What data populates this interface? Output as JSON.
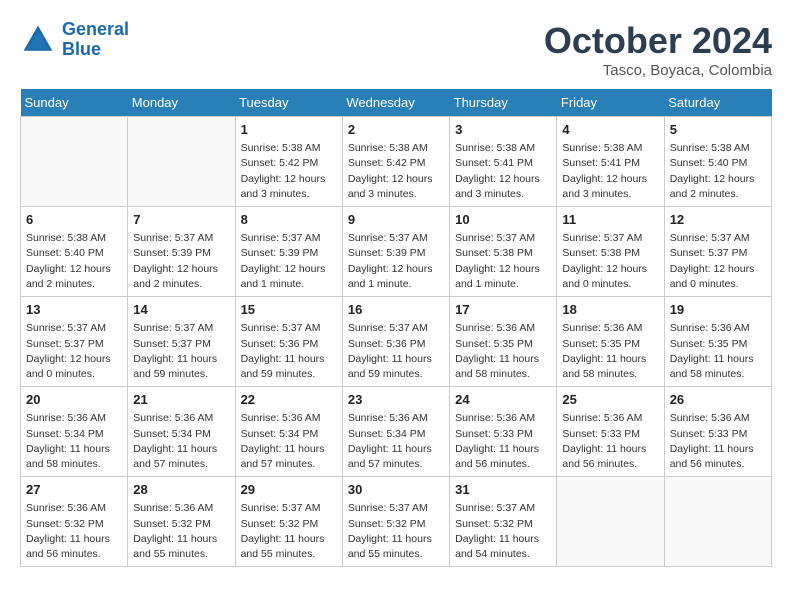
{
  "header": {
    "logo_line1": "General",
    "logo_line2": "Blue",
    "month": "October 2024",
    "location": "Tasco, Boyaca, Colombia"
  },
  "weekdays": [
    "Sunday",
    "Monday",
    "Tuesday",
    "Wednesday",
    "Thursday",
    "Friday",
    "Saturday"
  ],
  "weeks": [
    [
      {
        "day": "",
        "info": ""
      },
      {
        "day": "",
        "info": ""
      },
      {
        "day": "1",
        "info": "Sunrise: 5:38 AM\nSunset: 5:42 PM\nDaylight: 12 hours\nand 3 minutes."
      },
      {
        "day": "2",
        "info": "Sunrise: 5:38 AM\nSunset: 5:42 PM\nDaylight: 12 hours\nand 3 minutes."
      },
      {
        "day": "3",
        "info": "Sunrise: 5:38 AM\nSunset: 5:41 PM\nDaylight: 12 hours\nand 3 minutes."
      },
      {
        "day": "4",
        "info": "Sunrise: 5:38 AM\nSunset: 5:41 PM\nDaylight: 12 hours\nand 3 minutes."
      },
      {
        "day": "5",
        "info": "Sunrise: 5:38 AM\nSunset: 5:40 PM\nDaylight: 12 hours\nand 2 minutes."
      }
    ],
    [
      {
        "day": "6",
        "info": "Sunrise: 5:38 AM\nSunset: 5:40 PM\nDaylight: 12 hours\nand 2 minutes."
      },
      {
        "day": "7",
        "info": "Sunrise: 5:37 AM\nSunset: 5:39 PM\nDaylight: 12 hours\nand 2 minutes."
      },
      {
        "day": "8",
        "info": "Sunrise: 5:37 AM\nSunset: 5:39 PM\nDaylight: 12 hours\nand 1 minute."
      },
      {
        "day": "9",
        "info": "Sunrise: 5:37 AM\nSunset: 5:39 PM\nDaylight: 12 hours\nand 1 minute."
      },
      {
        "day": "10",
        "info": "Sunrise: 5:37 AM\nSunset: 5:38 PM\nDaylight: 12 hours\nand 1 minute."
      },
      {
        "day": "11",
        "info": "Sunrise: 5:37 AM\nSunset: 5:38 PM\nDaylight: 12 hours\nand 0 minutes."
      },
      {
        "day": "12",
        "info": "Sunrise: 5:37 AM\nSunset: 5:37 PM\nDaylight: 12 hours\nand 0 minutes."
      }
    ],
    [
      {
        "day": "13",
        "info": "Sunrise: 5:37 AM\nSunset: 5:37 PM\nDaylight: 12 hours\nand 0 minutes."
      },
      {
        "day": "14",
        "info": "Sunrise: 5:37 AM\nSunset: 5:37 PM\nDaylight: 11 hours\nand 59 minutes."
      },
      {
        "day": "15",
        "info": "Sunrise: 5:37 AM\nSunset: 5:36 PM\nDaylight: 11 hours\nand 59 minutes."
      },
      {
        "day": "16",
        "info": "Sunrise: 5:37 AM\nSunset: 5:36 PM\nDaylight: 11 hours\nand 59 minutes."
      },
      {
        "day": "17",
        "info": "Sunrise: 5:36 AM\nSunset: 5:35 PM\nDaylight: 11 hours\nand 58 minutes."
      },
      {
        "day": "18",
        "info": "Sunrise: 5:36 AM\nSunset: 5:35 PM\nDaylight: 11 hours\nand 58 minutes."
      },
      {
        "day": "19",
        "info": "Sunrise: 5:36 AM\nSunset: 5:35 PM\nDaylight: 11 hours\nand 58 minutes."
      }
    ],
    [
      {
        "day": "20",
        "info": "Sunrise: 5:36 AM\nSunset: 5:34 PM\nDaylight: 11 hours\nand 58 minutes."
      },
      {
        "day": "21",
        "info": "Sunrise: 5:36 AM\nSunset: 5:34 PM\nDaylight: 11 hours\nand 57 minutes."
      },
      {
        "day": "22",
        "info": "Sunrise: 5:36 AM\nSunset: 5:34 PM\nDaylight: 11 hours\nand 57 minutes."
      },
      {
        "day": "23",
        "info": "Sunrise: 5:36 AM\nSunset: 5:34 PM\nDaylight: 11 hours\nand 57 minutes."
      },
      {
        "day": "24",
        "info": "Sunrise: 5:36 AM\nSunset: 5:33 PM\nDaylight: 11 hours\nand 56 minutes."
      },
      {
        "day": "25",
        "info": "Sunrise: 5:36 AM\nSunset: 5:33 PM\nDaylight: 11 hours\nand 56 minutes."
      },
      {
        "day": "26",
        "info": "Sunrise: 5:36 AM\nSunset: 5:33 PM\nDaylight: 11 hours\nand 56 minutes."
      }
    ],
    [
      {
        "day": "27",
        "info": "Sunrise: 5:36 AM\nSunset: 5:32 PM\nDaylight: 11 hours\nand 56 minutes."
      },
      {
        "day": "28",
        "info": "Sunrise: 5:36 AM\nSunset: 5:32 PM\nDaylight: 11 hours\nand 55 minutes."
      },
      {
        "day": "29",
        "info": "Sunrise: 5:37 AM\nSunset: 5:32 PM\nDaylight: 11 hours\nand 55 minutes."
      },
      {
        "day": "30",
        "info": "Sunrise: 5:37 AM\nSunset: 5:32 PM\nDaylight: 11 hours\nand 55 minutes."
      },
      {
        "day": "31",
        "info": "Sunrise: 5:37 AM\nSunset: 5:32 PM\nDaylight: 11 hours\nand 54 minutes."
      },
      {
        "day": "",
        "info": ""
      },
      {
        "day": "",
        "info": ""
      }
    ]
  ]
}
